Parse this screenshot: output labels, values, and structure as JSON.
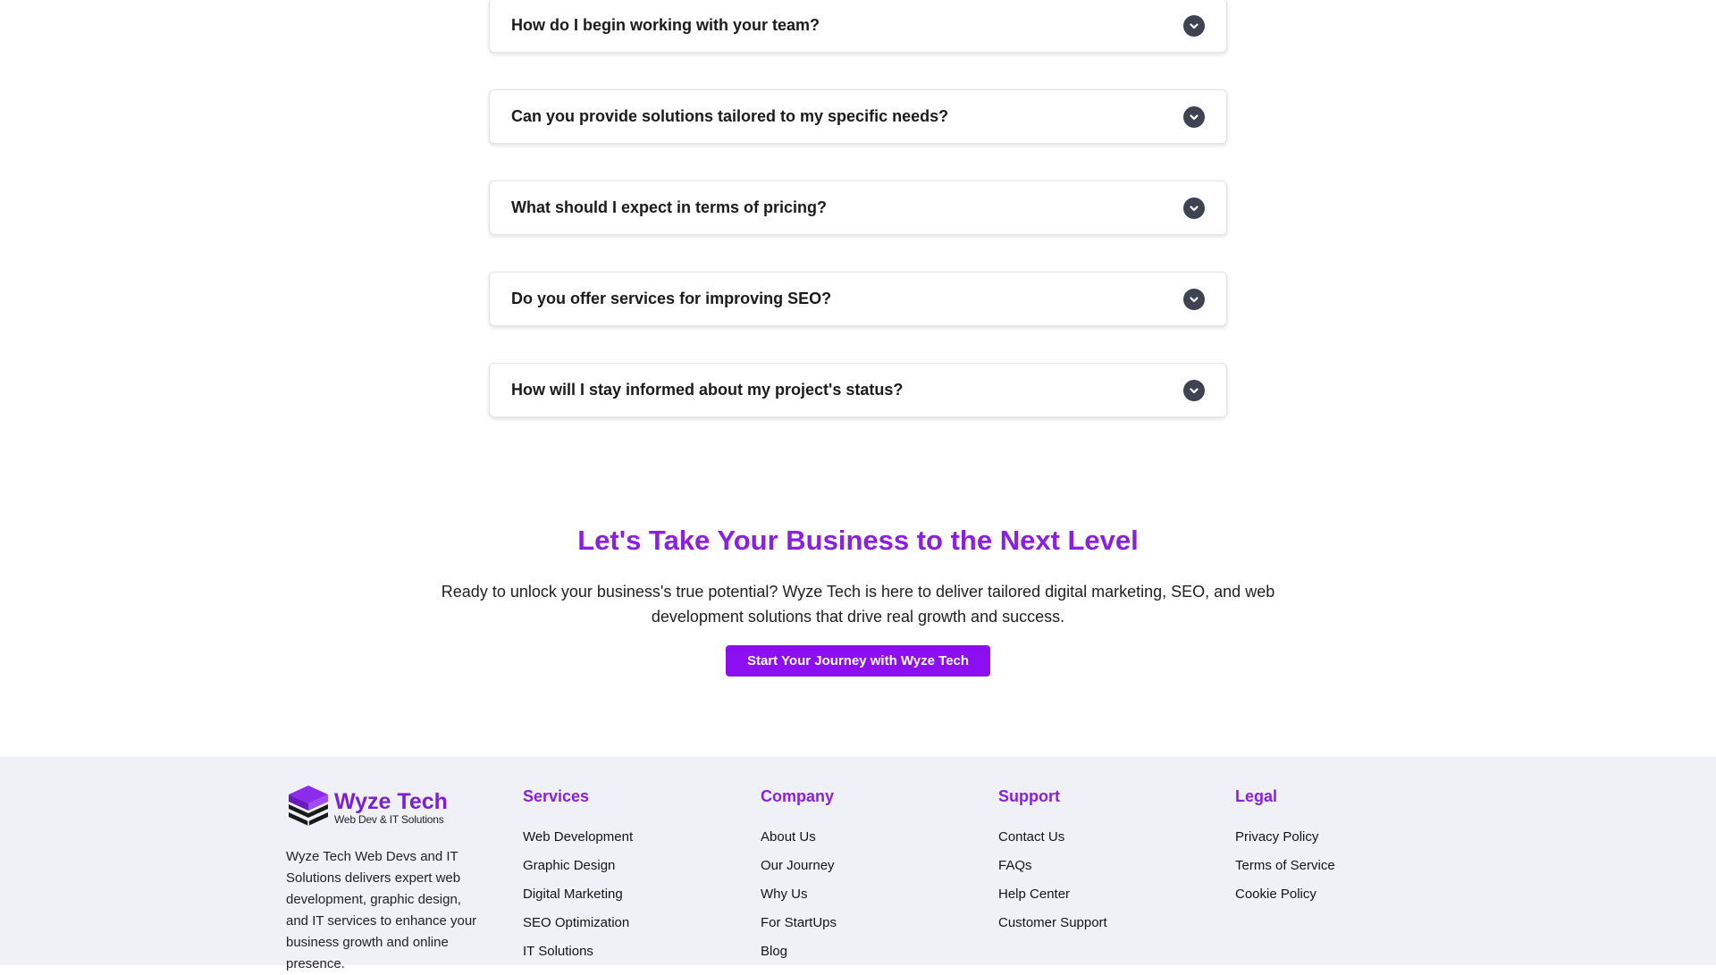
{
  "faq": {
    "items": [
      {
        "question": "How do I begin working with your team?"
      },
      {
        "question": "Can you provide solutions tailored to my specific needs?"
      },
      {
        "question": "What should I expect in terms of pricing?"
      },
      {
        "question": "Do you offer services for improving SEO?"
      },
      {
        "question": "How will I stay informed about my project's status?"
      }
    ]
  },
  "cta": {
    "title": "Let's Take Your Business to the Next Level",
    "text": "Ready to unlock your business's true potential? Wyze Tech is here to deliver tailored digital marketing, SEO, and web development solutions that drive real growth and success.",
    "button": "Start Your Journey with Wyze Tech"
  },
  "footer": {
    "brand": {
      "name": "Wyze Tech",
      "tagline": "Web Dev & IT Solutions",
      "description": "Wyze Tech Web Devs and IT Solutions delivers expert web development, graphic design, and IT services to enhance your business growth and online presence."
    },
    "columns": [
      {
        "title": "Services",
        "links": [
          "Web Development",
          "Graphic Design",
          "Digital Marketing",
          "SEO Optimization",
          "IT Solutions"
        ]
      },
      {
        "title": "Company",
        "links": [
          "About Us",
          "Our Journey",
          "Why Us",
          "For StartUps",
          "Blog"
        ]
      },
      {
        "title": "Support",
        "links": [
          "Contact Us",
          "FAQs",
          "Help Center",
          "Customer Support"
        ]
      },
      {
        "title": "Legal",
        "links": [
          "Privacy Policy",
          "Terms of Service",
          "Cookie Policy"
        ]
      }
    ]
  },
  "colors": {
    "accent": "#8a1fe0",
    "button": "#8d0ef0",
    "footer_bg": "#eff1f7",
    "chevron": "#3d4350"
  },
  "icons": {
    "faq_toggle": "chevron-down-icon",
    "logo": "stacked-books-logo-icon"
  }
}
